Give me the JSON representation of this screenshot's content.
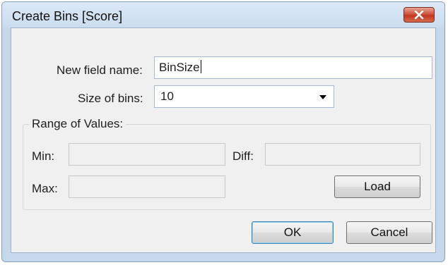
{
  "dialog": {
    "title": "Create Bins [Score]"
  },
  "fields": {
    "new_field_label": "New field name:",
    "new_field_value": "BinSize",
    "bin_size_label": "Size of bins:",
    "bin_size_value": "10"
  },
  "range": {
    "title": "Range of Values:",
    "min_label": "Min:",
    "min_value": "",
    "diff_label": "Diff:",
    "diff_value": "",
    "max_label": "Max:",
    "max_value": "",
    "load_label": "Load"
  },
  "buttons": {
    "ok_label": "OK",
    "cancel_label": "Cancel"
  },
  "colors": {
    "title_bar": "#c9dcef",
    "close_button": "#c2381f",
    "client_background": "#f0f0f0"
  }
}
